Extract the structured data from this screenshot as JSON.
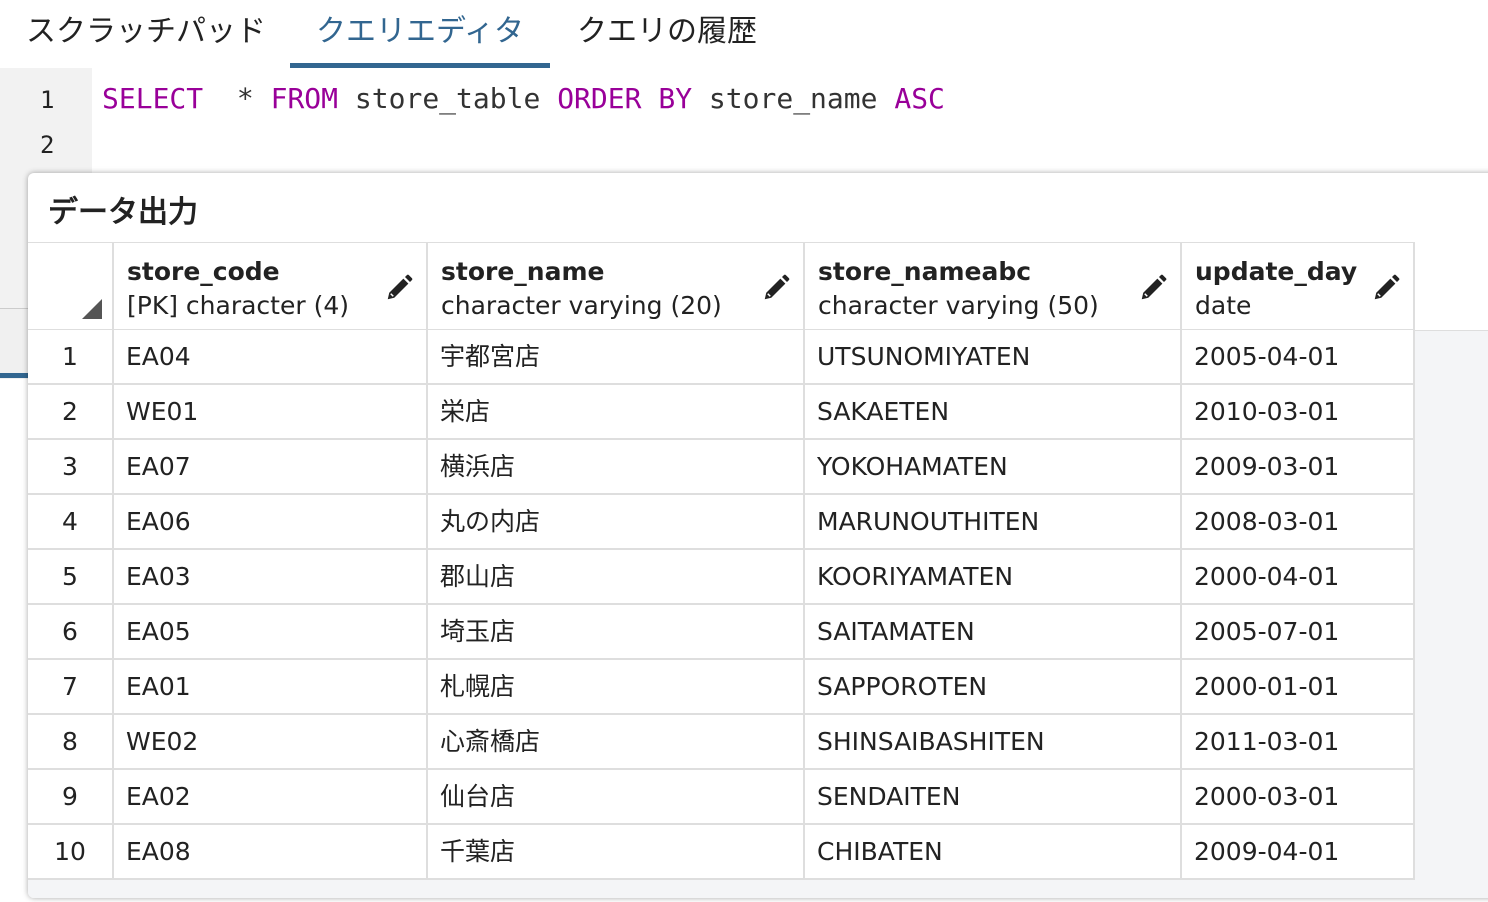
{
  "tabs": [
    {
      "label": "スクラッチパッド",
      "active": false
    },
    {
      "label": "クエリエディタ",
      "active": true
    },
    {
      "label": "クエリの履歴",
      "active": false
    }
  ],
  "editor": {
    "line_numbers": [
      "1",
      "2"
    ],
    "tokens": [
      {
        "text": "SELECT",
        "type": "keyword"
      },
      {
        "text": "  * ",
        "type": "plain"
      },
      {
        "text": "FROM",
        "type": "keyword"
      },
      {
        "text": " store_table ",
        "type": "plain"
      },
      {
        "text": "ORDER BY",
        "type": "keyword"
      },
      {
        "text": " store_name ",
        "type": "plain"
      },
      {
        "text": "ASC",
        "type": "keyword"
      }
    ],
    "keyword_color": "#990099"
  },
  "output": {
    "title": "データ出力",
    "columns": [
      {
        "name": "store_code",
        "type": "[PK] character (4)"
      },
      {
        "name": "store_name",
        "type": "character varying (20)"
      },
      {
        "name": "store_nameabc",
        "type": "character varying (50)"
      },
      {
        "name": "update_day",
        "type": "date"
      }
    ],
    "rows": [
      [
        "1",
        "EA04",
        "宇都宮店",
        "UTSUNOMIYATEN",
        "2005-04-01"
      ],
      [
        "2",
        "WE01",
        "栄店",
        "SAKAETEN",
        "2010-03-01"
      ],
      [
        "3",
        "EA07",
        "横浜店",
        "YOKOHAMATEN",
        "2009-03-01"
      ],
      [
        "4",
        "EA06",
        "丸の内店",
        "MARUNOUTHITEN",
        "2008-03-01"
      ],
      [
        "5",
        "EA03",
        "郡山店",
        "KOORIYAMATEN",
        "2000-04-01"
      ],
      [
        "6",
        "EA05",
        "埼玉店",
        "SAITAMATEN",
        "2005-07-01"
      ],
      [
        "7",
        "EA01",
        "札幌店",
        "SAPPOROTEN",
        "2000-01-01"
      ],
      [
        "8",
        "WE02",
        "心斎橋店",
        "SHINSAIBASHITEN",
        "2011-03-01"
      ],
      [
        "9",
        "EA02",
        "仙台店",
        "SENDAITEN",
        "2000-03-01"
      ],
      [
        "10",
        "EA08",
        "千葉店",
        "CHIBATEN",
        "2009-04-01"
      ]
    ]
  },
  "colors": {
    "accent": "#326690",
    "grid_border": "#dedede"
  }
}
